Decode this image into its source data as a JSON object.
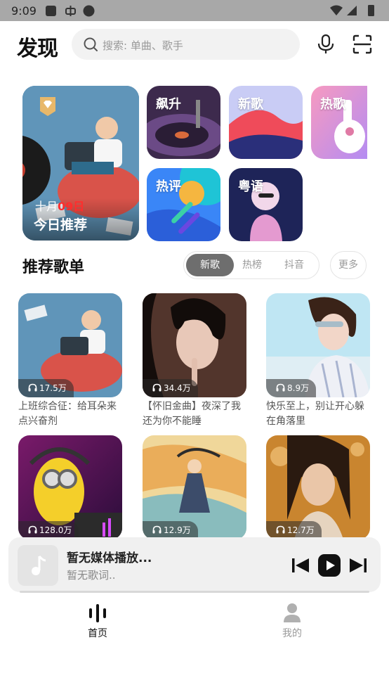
{
  "status_bar": {
    "time": "9:09"
  },
  "header": {
    "logo": "发现",
    "search_placeholder": "搜索: 单曲、歌手"
  },
  "featured": {
    "date_month": "十月",
    "date_day": "09日",
    "title": "今日推荐",
    "tiles": [
      {
        "label": "飙升"
      },
      {
        "label": "新歌"
      },
      {
        "label": "热歌"
      },
      {
        "label": "热评"
      },
      {
        "label": "粤语"
      }
    ]
  },
  "section": {
    "title": "推荐歌单",
    "tabs": [
      "新歌",
      "热榜",
      "抖音"
    ],
    "active_tab": "新歌",
    "more": "更多"
  },
  "playlists": [
    {
      "plays": "17.5万",
      "name": "上班综合征：给耳朵来点兴奋剂"
    },
    {
      "plays": "34.4万",
      "name": "【怀旧金曲】夜深了我还为你不能睡"
    },
    {
      "plays": "8.9万",
      "name": "快乐至上，别让开心躲在角落里"
    },
    {
      "plays": "128.0万",
      "name": ""
    },
    {
      "plays": "12.9万",
      "name": ""
    },
    {
      "plays": "12.7万",
      "name": ""
    }
  ],
  "player": {
    "title": "暂无媒体播放...",
    "lyric": "暂无歌词.."
  },
  "nav": {
    "home": "首页",
    "mine": "我的"
  },
  "colors": {
    "accent_date": "#ff2d2d",
    "active_tab_bg": "#6e6e6e",
    "nav_active": "#111111",
    "nav_inactive": "#9a9a9a"
  }
}
